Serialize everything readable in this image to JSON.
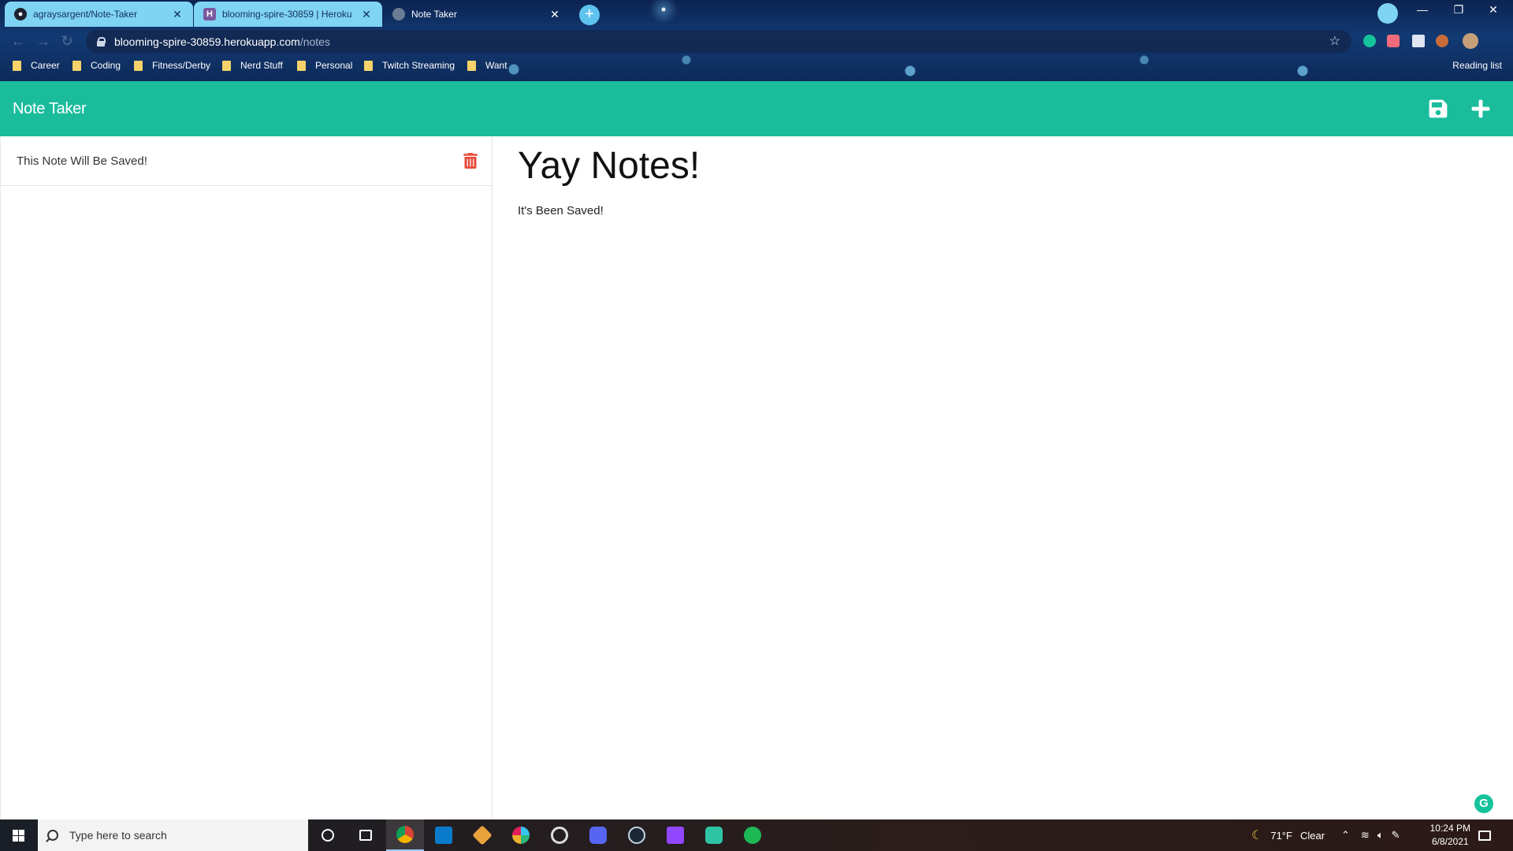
{
  "browser": {
    "tabs": [
      {
        "title": "agraysargent/Note-Taker",
        "icon": "github-icon"
      },
      {
        "title": "blooming-spire-30859 | Heroku",
        "icon": "heroku-icon"
      },
      {
        "title": "Note Taker",
        "icon": "globe-icon"
      }
    ],
    "url_host": "blooming-spire-30859.herokuapp.com",
    "url_path": "/notes",
    "bookmarks": [
      "Career",
      "Coding",
      "Fitness/Derby",
      "Nerd Stuff",
      "Personal",
      "Twitch Streaming",
      "Want"
    ],
    "reading_list": "Reading list"
  },
  "app": {
    "brand": "Note Taker",
    "accent_color": "#1abc9c",
    "delete_color": "#e74c3c",
    "notes": [
      {
        "title": "This Note Will Be Saved!"
      }
    ],
    "active_note": {
      "title": "Yay Notes!",
      "text": "It's Been Saved!"
    }
  },
  "taskbar": {
    "search_placeholder": "Type here to search",
    "weather_temp": "71°F",
    "weather_desc": "Clear",
    "time": "10:24 PM",
    "date": "6/8/2021"
  }
}
